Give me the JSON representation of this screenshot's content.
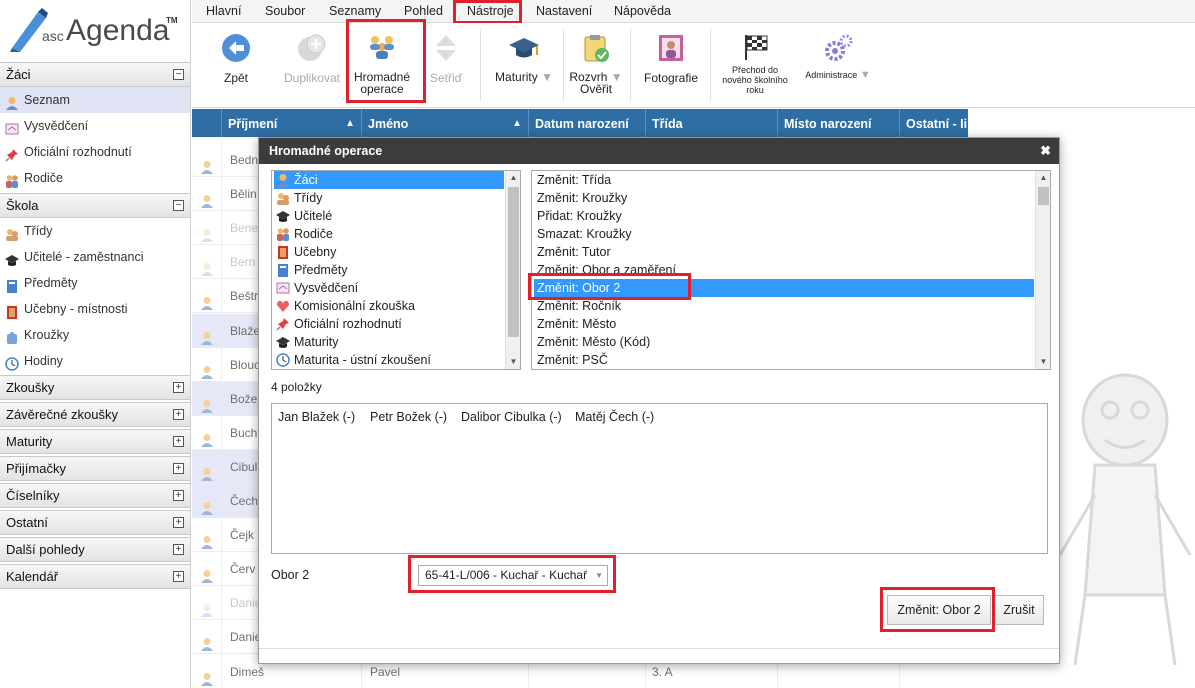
{
  "logo": {
    "small": "asc",
    "big": "Agenda",
    "tm": "TM"
  },
  "sidebar": {
    "sections": [
      {
        "label": "Žáci",
        "toggle": "−"
      },
      {
        "label": "Škola",
        "toggle": "−"
      },
      {
        "label": "Zkoušky",
        "toggle": "+"
      },
      {
        "label": "Závěrečné zkoušky",
        "toggle": "+"
      },
      {
        "label": "Maturity",
        "toggle": "+"
      },
      {
        "label": "Přijímačky",
        "toggle": "+"
      },
      {
        "label": "Číselníky",
        "toggle": "+"
      },
      {
        "label": "Ostatní",
        "toggle": "+"
      },
      {
        "label": "Další pohledy",
        "toggle": "+"
      },
      {
        "label": "Kalendář",
        "toggle": "+"
      }
    ],
    "zaci_items": [
      {
        "label": "Seznam",
        "icon": "student-icon"
      },
      {
        "label": "Vysvědčení",
        "icon": "certificate-icon"
      },
      {
        "label": "Oficiální rozhodnutí",
        "icon": "pin-icon"
      },
      {
        "label": "Rodiče",
        "icon": "parents-icon"
      }
    ],
    "skola_items": [
      {
        "label": "Třídy",
        "icon": "class-icon"
      },
      {
        "label": "Učitelé - zaměstnanci",
        "icon": "graduation-cap-icon"
      },
      {
        "label": "Předměty",
        "icon": "book-icon"
      },
      {
        "label": "Učebny - místnosti",
        "icon": "door-icon"
      },
      {
        "label": "Kroužky",
        "icon": "puzzle-icon"
      },
      {
        "label": "Hodiny",
        "icon": "clock-icon"
      }
    ]
  },
  "menubar": [
    "Hlavní",
    "Soubor",
    "Seznamy",
    "Pohled",
    "Nástroje",
    "Nastavení",
    "Nápověda"
  ],
  "toolbar": {
    "back": "Zpět",
    "duplicate": "Duplikovat",
    "bulk_line1": "Hromadné",
    "bulk_line2": "operace",
    "sort": "Setřiď",
    "maturity": "Maturity",
    "schedule_line1": "Rozvrh",
    "schedule_line2": "Ověřit",
    "photos": "Fotografie",
    "transition_line1": "Přechod do",
    "transition_line2": "nového školního",
    "transition_line3": "roku",
    "admin": "Administrace"
  },
  "grid": {
    "headers": [
      "Příjmení",
      "Jméno",
      "Datum narození",
      "Třída",
      "Místo narození",
      "Ostatní - Ii"
    ],
    "rows": [
      {
        "surname": "Bedn",
        "name": "",
        "class": "",
        "dim": false,
        "hl": false
      },
      {
        "surname": "Bělin",
        "name": "",
        "class": "",
        "dim": false,
        "hl": false
      },
      {
        "surname": "Bene",
        "name": "",
        "class": "",
        "dim": true,
        "hl": false
      },
      {
        "surname": "Bern",
        "name": "",
        "class": "",
        "dim": true,
        "hl": false
      },
      {
        "surname": "Beštr",
        "name": "",
        "class": "",
        "dim": false,
        "hl": false
      },
      {
        "surname": "Blaže",
        "name": "",
        "class": "",
        "dim": false,
        "hl": true
      },
      {
        "surname": "Blouc",
        "name": "",
        "class": "",
        "dim": false,
        "hl": false
      },
      {
        "surname": "Bože",
        "name": "",
        "class": "",
        "dim": false,
        "hl": true
      },
      {
        "surname": "Buch",
        "name": "",
        "class": "",
        "dim": false,
        "hl": false
      },
      {
        "surname": "Cibul",
        "name": "",
        "class": "",
        "dim": false,
        "hl": true
      },
      {
        "surname": "Čech",
        "name": "",
        "class": "",
        "dim": false,
        "hl": true
      },
      {
        "surname": "Čejk",
        "name": "",
        "class": "",
        "dim": false,
        "hl": false
      },
      {
        "surname": "Červ",
        "name": "",
        "class": "",
        "dim": false,
        "hl": false
      },
      {
        "surname": "Danie",
        "name": "",
        "class": "",
        "dim": true,
        "hl": false
      },
      {
        "surname": "Danie",
        "name": "",
        "class": "",
        "dim": false,
        "hl": false
      },
      {
        "surname": "Dimeš",
        "name": "Pavel",
        "class": "3. A",
        "dim": false,
        "hl": false
      }
    ]
  },
  "dialog": {
    "title": "Hromadné operace",
    "close": "✖",
    "categories": [
      {
        "label": "Žáci",
        "icon": "student-icon"
      },
      {
        "label": "Třídy",
        "icon": "class-icon"
      },
      {
        "label": "Učitelé",
        "icon": "graduation-cap-icon"
      },
      {
        "label": "Rodiče",
        "icon": "parents-icon"
      },
      {
        "label": "Učebny",
        "icon": "door-icon"
      },
      {
        "label": "Předměty",
        "icon": "book-icon"
      },
      {
        "label": "Vysvědčení",
        "icon": "certificate-icon"
      },
      {
        "label": "Komisionální zkouška",
        "icon": "heart-icon"
      },
      {
        "label": "Oficiální rozhodnutí",
        "icon": "pin-icon"
      },
      {
        "label": "Maturity",
        "icon": "graduation-cap-icon"
      },
      {
        "label": "Maturita - ústní zkoušení",
        "icon": "clock-icon"
      }
    ],
    "operations": [
      "Změnit: Třída",
      "Změnit: Kroužky",
      "Přidat: Kroužky",
      "Smazat: Kroužky",
      "Změnit: Tutor",
      "Změnit: Obor a zaměření",
      "Změnit: Obor 2",
      "Změnit: Ročník",
      "Změnit: Město",
      "Změnit: Město (Kód)",
      "Změnit: PSČ"
    ],
    "selected_operation_index": 6,
    "count_label": "4 položky",
    "selected_students": [
      "Jan Blažek (-)",
      "Petr Božek (-)",
      "Dalibor Cibulka (-)",
      "Matěj Čech (-)"
    ],
    "field_label": "Obor 2",
    "field_value": "65-41-L/006 - Kuchař - Kuchař",
    "apply_button": "Změnit: Obor 2",
    "cancel_button": "Zrušit"
  },
  "colors": {
    "accent": "#2f6ea5",
    "highlight": "#e0202a",
    "selection": "#3399ff"
  }
}
